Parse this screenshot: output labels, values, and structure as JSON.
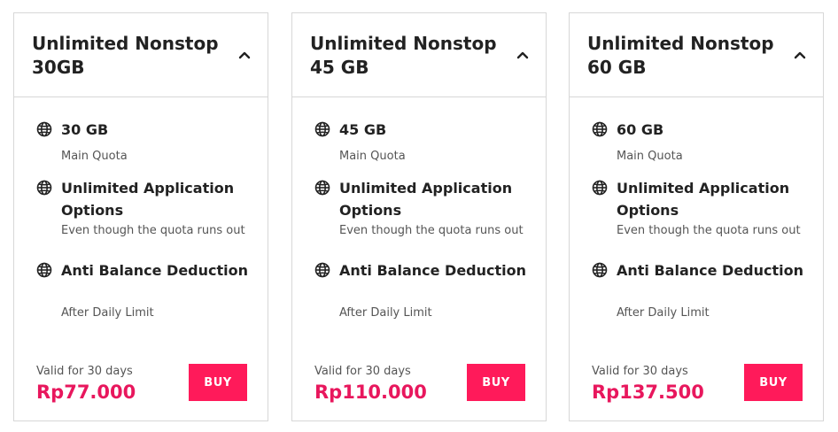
{
  "colors": {
    "accent": "#ff1a5a",
    "price": "#e8175d",
    "border": "#d7d7d7",
    "text": "#222222",
    "muted": "#555555"
  },
  "icons": {
    "feature": "globe-icon",
    "header_toggle": "chevron-up-icon"
  },
  "packages": [
    {
      "title": "Unlimited Nonstop 30GB",
      "features": [
        {
          "title": "30 GB",
          "description": "Main Quota"
        },
        {
          "title": "Unlimited Application Options",
          "description": "Even though the quota runs out"
        },
        {
          "title": "Anti Balance Deduction",
          "description": "After Daily Limit"
        }
      ],
      "validity": "Valid for 30 days",
      "price": "Rp77.000",
      "buy_label": "BUY"
    },
    {
      "title": "Unlimited Nonstop 45 GB",
      "features": [
        {
          "title": "45 GB",
          "description": "Main Quota"
        },
        {
          "title": "Unlimited Application Options",
          "description": "Even though the quota runs out"
        },
        {
          "title": "Anti Balance Deduction",
          "description": "After Daily Limit"
        }
      ],
      "validity": "Valid for 30 days",
      "price": "Rp110.000",
      "buy_label": "BUY"
    },
    {
      "title": "Unlimited Nonstop 60 GB",
      "features": [
        {
          "title": "60 GB",
          "description": "Main Quota"
        },
        {
          "title": "Unlimited Application Options",
          "description": "Even though the quota runs out"
        },
        {
          "title": "Anti Balance Deduction",
          "description": "After Daily Limit"
        }
      ],
      "validity": "Valid for 30 days",
      "price": "Rp137.500",
      "buy_label": "BUY"
    }
  ]
}
